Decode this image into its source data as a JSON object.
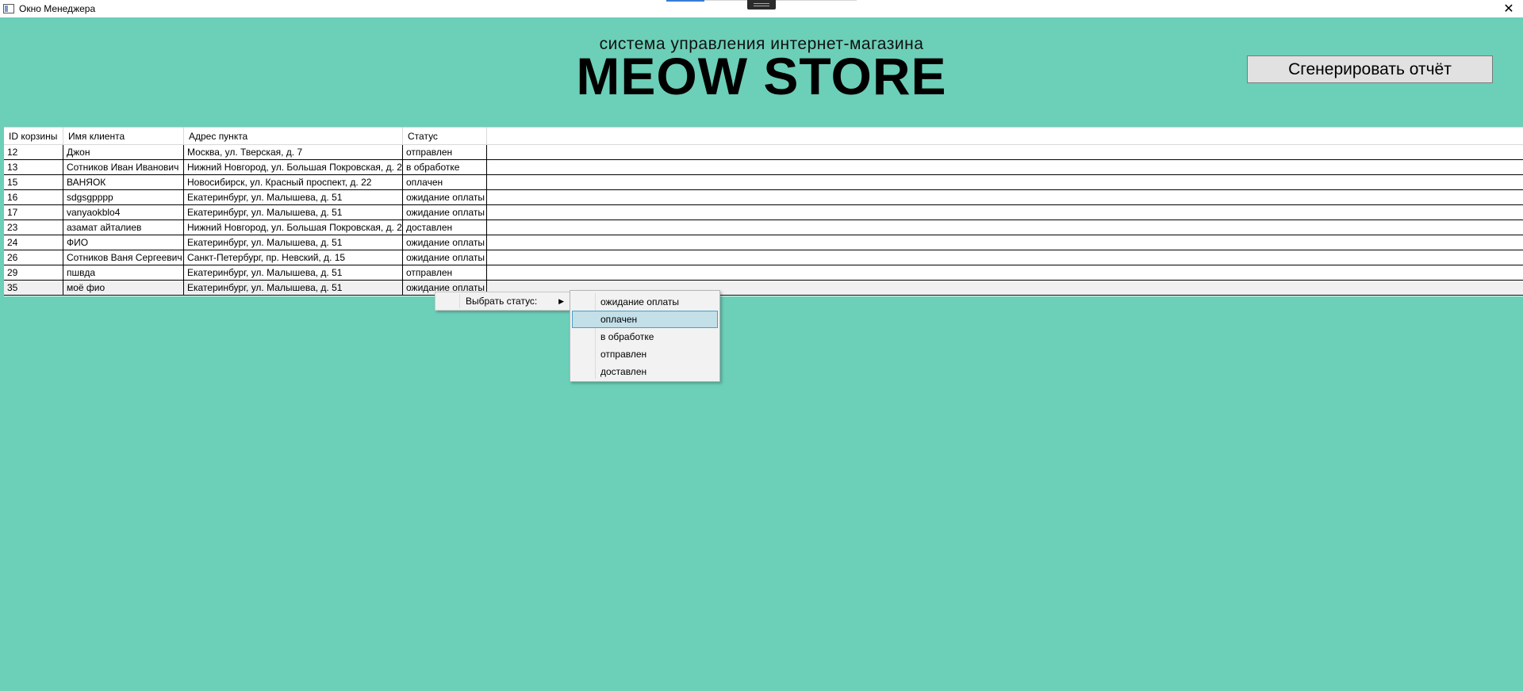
{
  "window": {
    "title": "Окно Менеджера",
    "close_glyph": "✕"
  },
  "header": {
    "subtitle": "система управления интернет-магазина",
    "brand": "MEOW STORE",
    "report_button": "Сгенерировать отчёт"
  },
  "grid": {
    "columns": [
      "ID корзины",
      "Имя клиента",
      "Адрес пункта",
      "Статус"
    ],
    "rows": [
      {
        "id": "12",
        "name": "Джон",
        "address": "Москва, ул. Тверская, д. 7",
        "status": "отправлен"
      },
      {
        "id": "13",
        "name": "Сотников Иван Иванович",
        "address": "Нижний Новгород, ул. Большая Покровская, д. 2",
        "status": "в обработке"
      },
      {
        "id": "15",
        "name": "ВАНЯОК",
        "address": "Новосибирск, ул. Красный проспект, д. 22",
        "status": "оплачен"
      },
      {
        "id": "16",
        "name": "sdgsgpppp",
        "address": "Екатеринбург, ул. Малышева, д. 51",
        "status": "ожидание оплаты"
      },
      {
        "id": "17",
        "name": "vanyaokblo4",
        "address": "Екатеринбург, ул. Малышева, д. 51",
        "status": "ожидание оплаты"
      },
      {
        "id": "23",
        "name": "азамат айталиев",
        "address": "Нижний Новгород, ул. Большая Покровская, д. 2",
        "status": "доставлен"
      },
      {
        "id": "24",
        "name": "ФИО",
        "address": "Екатеринбург, ул. Малышева, д. 51",
        "status": "ожидание оплаты"
      },
      {
        "id": "26",
        "name": "Сотников Ваня Сергеевич",
        "address": "Санкт-Петербург, пр. Невский, д. 15",
        "status": "ожидание оплаты"
      },
      {
        "id": "29",
        "name": "пшвда",
        "address": "Екатеринбург, ул. Малышева, д. 51",
        "status": "отправлен"
      },
      {
        "id": "35",
        "name": "моё фио",
        "address": "Екатеринбург, ул. Малышева, д. 51",
        "status": "ожидание оплаты"
      }
    ]
  },
  "context_menu": {
    "item_label": "Выбрать статус:",
    "submenu": [
      "ожидание оплаты",
      "оплачен",
      "в обработке",
      "отправлен",
      "доставлен"
    ],
    "highlighted": "оплачен"
  },
  "colors": {
    "background": "#6ccfb8",
    "highlight": "#c3dfe8"
  }
}
